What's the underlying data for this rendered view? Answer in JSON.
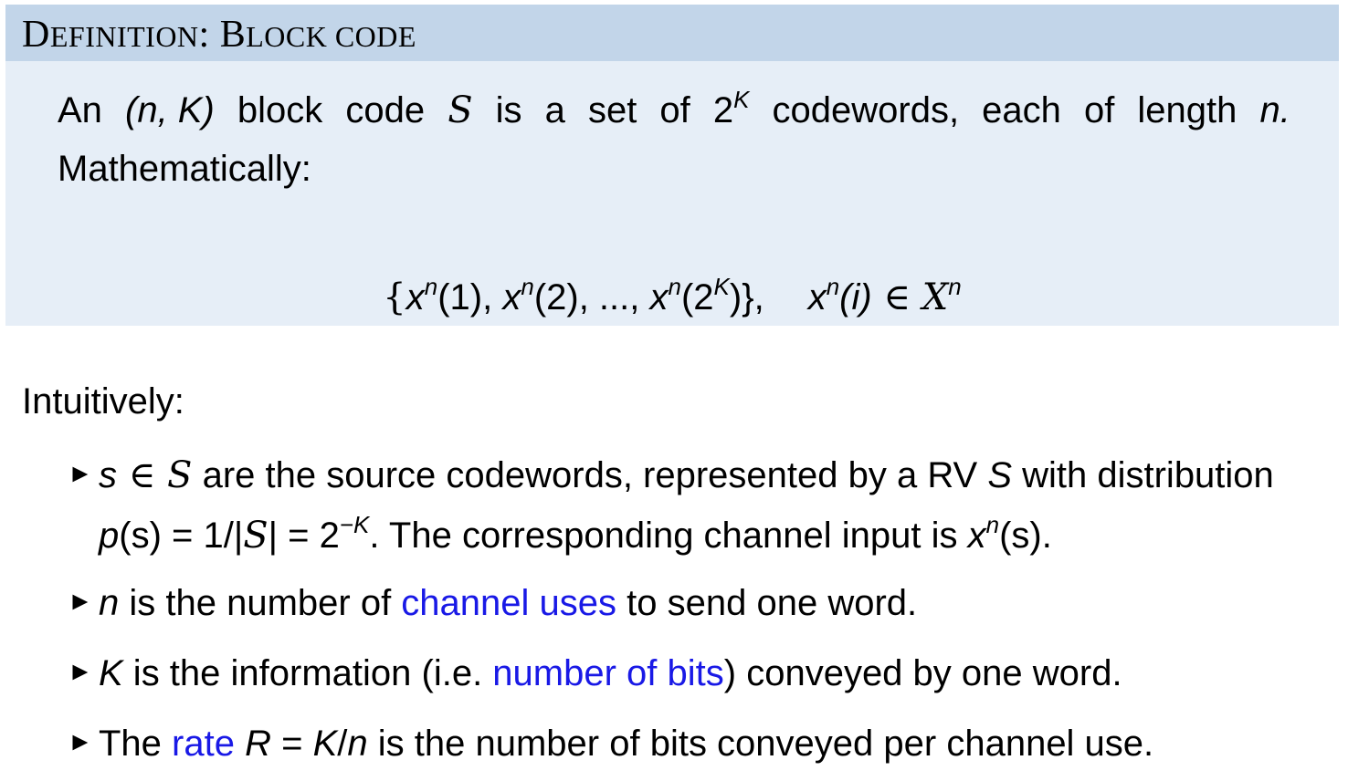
{
  "block": {
    "title_first": "D",
    "title_rest": "EFINITION",
    "title_colon": ": ",
    "title_b": "B",
    "title_rest2": "LOCK CODE",
    "line1": {
      "w1": "An",
      "w2": "(n, K)",
      "w3": "block",
      "w4": "code",
      "w5": "S",
      "w6": "is",
      "w7": "a",
      "w8": "set",
      "w9": "of",
      "w10_base": "2",
      "w10_sup": "K",
      "w11": "codewords,",
      "w12": "each",
      "w13": "of",
      "w14": "length",
      "w15": "n."
    },
    "line2": "Mathematically:",
    "display": {
      "set_open": "{",
      "x": "x",
      "n": "n",
      "arg1": "(1), ",
      "arg2": "(2), ..., ",
      "arg3_open": "(2",
      "arg3_sup": "K",
      "arg3_close": ")}",
      "sep": ",",
      "elem_arg": "(i)",
      "in": " ∈ ",
      "calX": "X"
    }
  },
  "intro": "Intuitively:",
  "bullets": {
    "marker": "►",
    "b1": {
      "s": "s",
      "in": " ∈ ",
      "calS": "S",
      "text1": " are the source codewords, represented by a RV ",
      "S": "S",
      "text2": " with distribution",
      "p": "p",
      "ps": "(s) = 1/|",
      "cal2": "S",
      "eq": "| = 2",
      "exp": "−K",
      "text3": ". The corresponding channel input is ",
      "x": "x",
      "xn": "n",
      "xs": "(s)."
    },
    "b2": {
      "n": "n",
      "t1": " is the number of ",
      "link": "channel uses",
      "t2": " to send one word."
    },
    "b3": {
      "K": "K",
      "t1": " is the information (i.e. ",
      "link": "number of bits",
      "t2": ") conveyed by one word."
    },
    "b4": {
      "t1": "The ",
      "link": "rate",
      "R": "R",
      "eq": " = ",
      "K": "K",
      "slash": "/",
      "n": "n",
      "t2": " is the number of bits conveyed per channel use."
    }
  },
  "colors": {
    "title_bg": "#c2d5e9",
    "body_bg": "#e6eef7",
    "link": "#1919e6"
  }
}
